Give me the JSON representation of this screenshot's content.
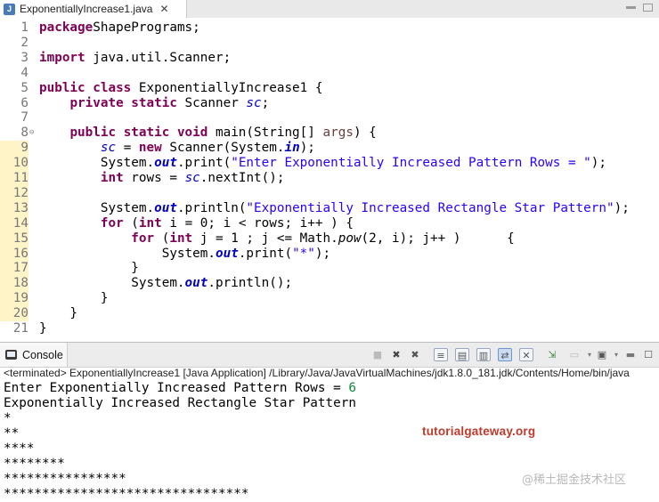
{
  "editor": {
    "tab_title": "ExponentiallyIncrease1.java",
    "tab_close": "✕",
    "lines": [
      {
        "n": "1",
        "tokens": [
          [
            "kw",
            "package"
          ],
          [
            "",
            "ShapePrograms;"
          ]
        ]
      },
      {
        "n": "2",
        "tokens": []
      },
      {
        "n": "3",
        "tokens": [
          [
            "kw",
            "import"
          ],
          [
            "",
            " java.util.Scanner;"
          ]
        ]
      },
      {
        "n": "4",
        "tokens": []
      },
      {
        "n": "5",
        "tokens": [
          [
            "kw",
            "public class"
          ],
          [
            "",
            " ExponentiallyIncrease1 {"
          ]
        ]
      },
      {
        "n": "6",
        "tokens": [
          [
            "",
            "    "
          ],
          [
            "kw",
            "private static"
          ],
          [
            "",
            " Scanner "
          ],
          [
            "fld",
            "sc"
          ],
          [
            "",
            ";"
          ]
        ]
      },
      {
        "n": "7",
        "tokens": []
      },
      {
        "n": "8",
        "fold": "⊖",
        "tokens": [
          [
            "",
            "    "
          ],
          [
            "kw",
            "public static void"
          ],
          [
            "",
            " main(String[] "
          ],
          [
            "prm",
            "args"
          ],
          [
            "",
            ") {"
          ]
        ]
      },
      {
        "n": "9",
        "hl": true,
        "tokens": [
          [
            "",
            "        "
          ],
          [
            "fld",
            "sc"
          ],
          [
            "",
            " = "
          ],
          [
            "kw",
            "new"
          ],
          [
            "",
            " Scanner(System."
          ],
          [
            "sfld",
            "in"
          ],
          [
            "",
            ");"
          ]
        ]
      },
      {
        "n": "10",
        "hl": true,
        "tokens": [
          [
            "",
            "        System."
          ],
          [
            "sfld",
            "out"
          ],
          [
            "",
            ".print("
          ],
          [
            "str",
            "\"Enter Exponentially Increased Pattern Rows = \""
          ],
          [
            "",
            ");"
          ]
        ]
      },
      {
        "n": "11",
        "hl": true,
        "tokens": [
          [
            "",
            "        "
          ],
          [
            "kw",
            "int"
          ],
          [
            "",
            " rows = "
          ],
          [
            "fld",
            "sc"
          ],
          [
            "",
            ".nextInt();"
          ]
        ]
      },
      {
        "n": "12",
        "hl": true,
        "tokens": []
      },
      {
        "n": "13",
        "hl": true,
        "tokens": [
          [
            "",
            "        System."
          ],
          [
            "sfld",
            "out"
          ],
          [
            "",
            ".println("
          ],
          [
            "str",
            "\"Exponentially Increased Rectangle Star Pattern\""
          ],
          [
            "",
            ");"
          ]
        ]
      },
      {
        "n": "14",
        "hl": true,
        "tokens": [
          [
            "",
            "        "
          ],
          [
            "kw",
            "for"
          ],
          [
            "",
            " ("
          ],
          [
            "kw",
            "int"
          ],
          [
            "",
            " i = 0; i < rows; i++ ) {"
          ]
        ]
      },
      {
        "n": "15",
        "hl": true,
        "tokens": [
          [
            "",
            "            "
          ],
          [
            "kw",
            "for"
          ],
          [
            "",
            " ("
          ],
          [
            "kw",
            "int"
          ],
          [
            "",
            " j = 1 ; j <= Math."
          ],
          [
            "smeth",
            "pow"
          ],
          [
            "",
            "(2, i); j++ )      {"
          ]
        ]
      },
      {
        "n": "16",
        "hl": true,
        "tokens": [
          [
            "",
            "                System."
          ],
          [
            "sfld",
            "out"
          ],
          [
            "",
            ".print("
          ],
          [
            "str",
            "\"*\""
          ],
          [
            "",
            ");"
          ]
        ]
      },
      {
        "n": "17",
        "hl": true,
        "tokens": [
          [
            "",
            "            }"
          ]
        ]
      },
      {
        "n": "18",
        "hl": true,
        "tokens": [
          [
            "",
            "            System."
          ],
          [
            "sfld",
            "out"
          ],
          [
            "",
            ".println();"
          ]
        ]
      },
      {
        "n": "19",
        "hl": true,
        "tokens": [
          [
            "",
            "        }"
          ]
        ]
      },
      {
        "n": "20",
        "hl": true,
        "tokens": [
          [
            "",
            "    }"
          ]
        ]
      },
      {
        "n": "21",
        "tokens": [
          [
            "",
            "}"
          ]
        ]
      }
    ]
  },
  "console": {
    "tab_label": "Console",
    "terminated": "<terminated> ExponentiallyIncrease1 [Java Application] /Library/Java/JavaVirtualMachines/jdk1.8.0_181.jdk/Contents/Home/bin/java",
    "prompt": "Enter Exponentially Increased Pattern Rows = ",
    "input_value": "6",
    "output_lines": [
      "Exponentially Increased Rectangle Star Pattern",
      "*",
      "**",
      "****",
      "********",
      "****************",
      "********************************"
    ]
  },
  "watermark": "tutorialgateway.org",
  "watermark_site": "@稀土掘金技术社区"
}
